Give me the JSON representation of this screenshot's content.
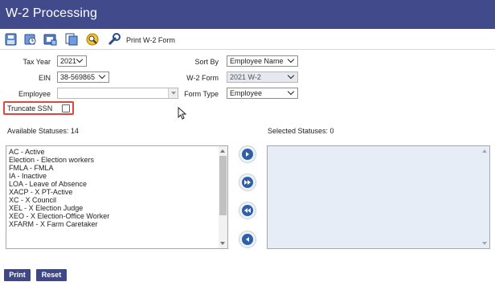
{
  "window": {
    "title": "W-2 Processing"
  },
  "toolbar": {
    "icons": [
      "save-icon",
      "open-icon",
      "print-preview-icon",
      "copy-icon",
      "search-icon",
      "tools-icon"
    ],
    "print_form_label": "Print W-2 Form"
  },
  "form": {
    "tax_year": {
      "label": "Tax Year",
      "value": "2021"
    },
    "ein": {
      "label": "EIN",
      "value": "38-569865"
    },
    "employee": {
      "label": "Employee",
      "value": ""
    },
    "sort_by": {
      "label": "Sort By",
      "value": "Employee Name"
    },
    "w2_form": {
      "label": "W-2 Form",
      "value": "2021 W-2"
    },
    "form_type": {
      "label": "Form Type",
      "value": "Employee"
    },
    "truncate_ssn": {
      "label": "Truncate SSN",
      "checked": false
    }
  },
  "available": {
    "label": "Available Statuses: 14",
    "items": [
      "AC - Active",
      "Election - Election workers",
      "FMLA - FMLA",
      "IA - Inactive",
      "LOA - Leave of Absence",
      "XACP - X PT-Active",
      "XC - X Council",
      "XEL - X Election Judge",
      "XEO - X Election-Office Worker",
      "XFARM - X Farm Caretaker"
    ]
  },
  "selected": {
    "label": "Selected Statuses: 0",
    "items": []
  },
  "move_buttons": [
    "move-right-icon",
    "move-all-right-icon",
    "move-all-left-icon",
    "move-left-icon"
  ],
  "footer": {
    "print_label": "Print",
    "reset_label": "Reset"
  }
}
